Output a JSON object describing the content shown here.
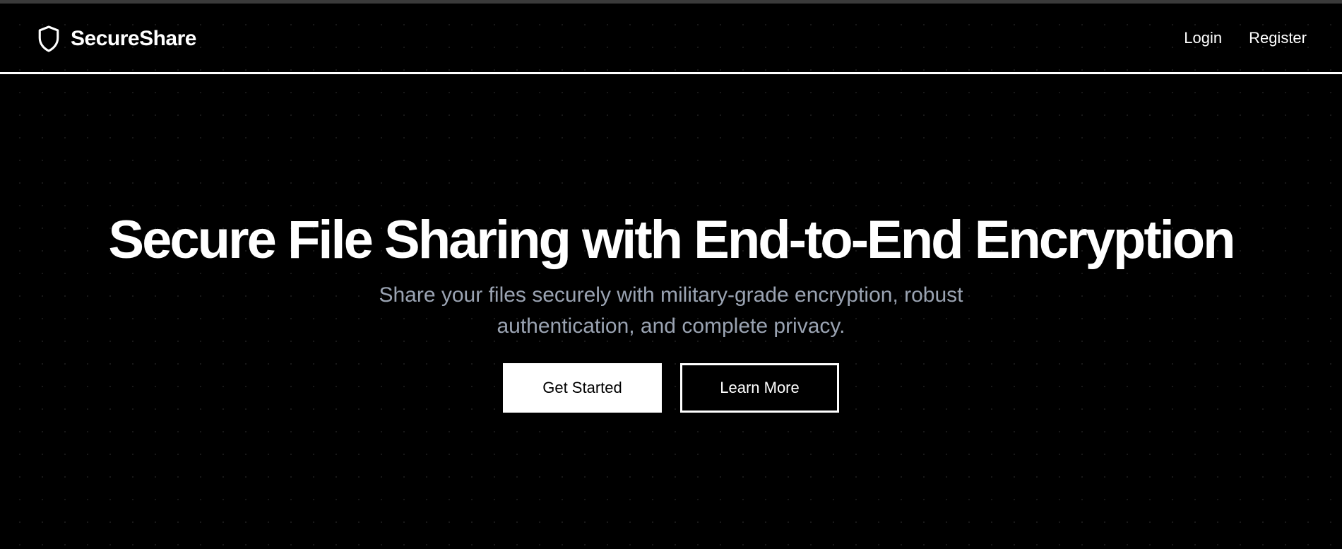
{
  "colors": {
    "background": "#000000",
    "foreground": "#ffffff",
    "muted_text": "#9aa3b2",
    "top_strip": "#3a3a3a"
  },
  "navbar": {
    "brand": {
      "icon": "shield-icon",
      "name": "SecureShare"
    },
    "links": {
      "login": "Login",
      "register": "Register"
    }
  },
  "hero": {
    "title": "Secure File Sharing with End-to-End Encryption",
    "subtitle": "Share your files securely with military-grade encryption, robust authentication, and complete privacy.",
    "primary_cta": "Get Started",
    "secondary_cta": "Learn More"
  }
}
